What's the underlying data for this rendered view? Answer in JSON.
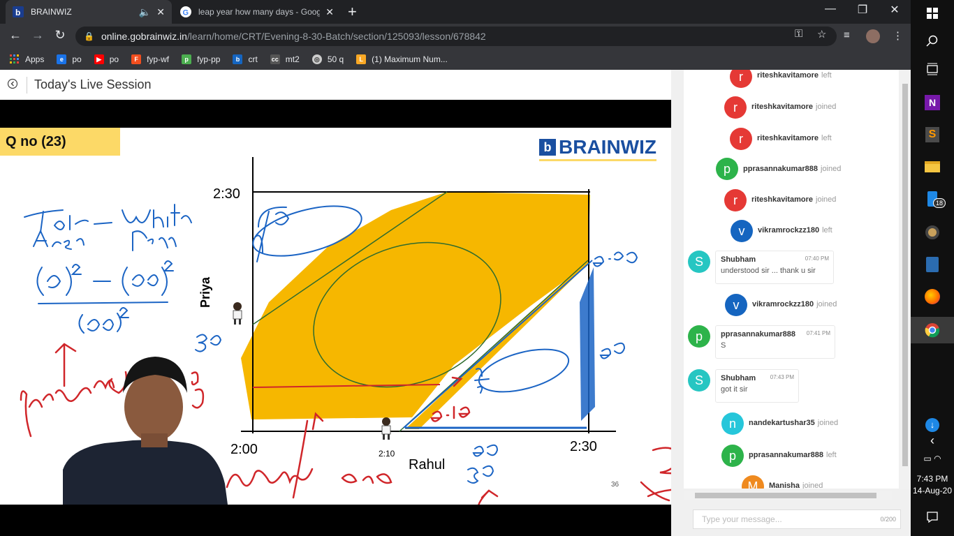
{
  "tabs": [
    {
      "title": "BRAINWIZ",
      "active": true
    },
    {
      "title": "leap year how many days - Goog",
      "active": false
    }
  ],
  "omnibox": {
    "host": "online.gobrainwiz.in",
    "path": "/learn/home/CRT/Evening-8-30-Batch/section/125093/lesson/678842"
  },
  "bookmarks": [
    {
      "label": "Apps",
      "color": "#e8eaed"
    },
    {
      "label": "po",
      "color": "#1a73e8"
    },
    {
      "label": "po",
      "color": "#ff0000"
    },
    {
      "label": "fyp-wf",
      "color": "#f24e1e"
    },
    {
      "label": "fyp-pp",
      "color": "#4caf50"
    },
    {
      "label": "crt",
      "color": "#1565c0"
    },
    {
      "label": "mt2",
      "color": "#555555"
    },
    {
      "label": "50 q",
      "color": "#cccccc"
    },
    {
      "label": "(1) Maximum Num...",
      "color": "#f9a825"
    }
  ],
  "page": {
    "title": "Today's Live Session"
  },
  "slide": {
    "question": "Q no (23)",
    "brand": "BRAINWIZ",
    "y_top": "2:30",
    "y_label": "Priya",
    "x_start": "2:00",
    "x_end": "2:30",
    "x_mid": "2:10",
    "x_label": "Rahul",
    "page_num": "36"
  },
  "chat": {
    "events": [
      {
        "initial": "r",
        "name": "riteshkavitamore",
        "status": "left",
        "color": "#e53935"
      },
      {
        "initial": "r",
        "name": "riteshkavitamore",
        "status": "joined",
        "color": "#e53935"
      },
      {
        "initial": "r",
        "name": "riteshkavitamore",
        "status": "left",
        "color": "#e53935"
      },
      {
        "initial": "p",
        "name": "pprasannakumar888",
        "status": "joined",
        "color": "#2db34a"
      },
      {
        "initial": "r",
        "name": "riteshkavitamore",
        "status": "joined",
        "color": "#e53935"
      },
      {
        "initial": "v",
        "name": "vikramrockzz180",
        "status": "left",
        "color": "#1565c0"
      },
      {
        "initial": "v",
        "name": "vikramrockzz180",
        "status": "joined",
        "color": "#1565c0"
      },
      {
        "initial": "n",
        "name": "nandekartushar35",
        "status": "joined",
        "color": "#26c6da"
      },
      {
        "initial": "p",
        "name": "pprasannakumar888",
        "status": "left",
        "color": "#2db34a"
      },
      {
        "initial": "M",
        "name": "Manisha",
        "status": "joined",
        "color": "#ef8a1f"
      }
    ],
    "messages": [
      {
        "initial": "S",
        "name": "Shubham",
        "time": "07:40 PM",
        "text": "understood sir ... thank u sir",
        "color": "#26c6c2"
      },
      {
        "initial": "p",
        "name": "pprasannakumar888",
        "time": "07:41 PM",
        "text": "S",
        "color": "#2db34a"
      },
      {
        "initial": "S",
        "name": "Shubham",
        "time": "07:43 PM",
        "text": "got it sir",
        "color": "#26c6c2"
      }
    ],
    "input_placeholder": "Type your message...",
    "char_count": "0/200"
  },
  "taskbar": {
    "time": "7:43 PM",
    "date": "14-Aug-20",
    "badge": "18"
  }
}
